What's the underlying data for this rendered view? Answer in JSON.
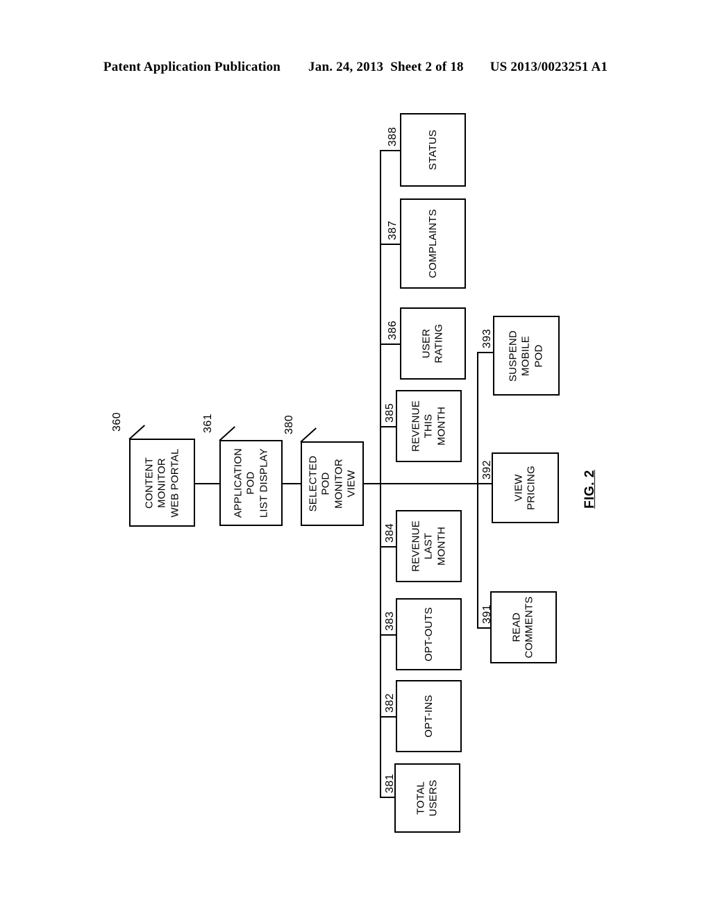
{
  "header": {
    "publication": "Patent Application Publication",
    "date": "Jan. 24, 2013",
    "sheet": "Sheet 2 of 18",
    "patent_number": "US 2013/0023251 A1"
  },
  "figure": {
    "label": "FIG. 2",
    "orientation": "landscape-rotated-90ccw"
  },
  "diagram": {
    "chain": [
      {
        "ref": "360",
        "label": "CONTENT\nMONITOR\nWEB PORTAL"
      },
      {
        "ref": "361",
        "label": "APPLICATION\nPOD\nLIST DISPLAY"
      },
      {
        "ref": "380",
        "label": "SELECTED\nPOD\nMONITOR\nVIEW"
      }
    ],
    "metrics_branch": [
      {
        "ref": "388",
        "label": "STATUS"
      },
      {
        "ref": "387",
        "label": "COMPLAINTS"
      },
      {
        "ref": "386",
        "label": "USER\nRATING"
      },
      {
        "ref": "385",
        "label": "REVENUE\nTHIS\nMONTH"
      },
      {
        "ref": "384",
        "label": "REVENUE\nLAST\nMONTH"
      },
      {
        "ref": "383",
        "label": "OPT-OUTS"
      },
      {
        "ref": "382",
        "label": "OPT-INS"
      },
      {
        "ref": "381",
        "label": "TOTAL\nUSERS"
      }
    ],
    "actions_branch": [
      {
        "ref": "393",
        "label": "SUSPEND\nMOBILE\nPOD"
      },
      {
        "ref": "392",
        "label": "VIEW\nPRICING"
      },
      {
        "ref": "391",
        "label": "READ\nCOMMENTS"
      }
    ]
  }
}
